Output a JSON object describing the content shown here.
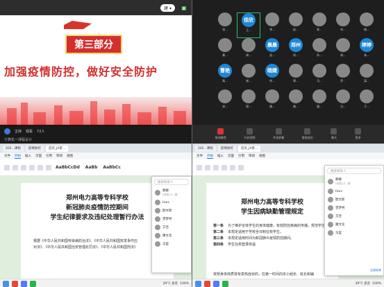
{
  "meeting": {
    "user_pill": "建 ▾",
    "slide": {
      "badge": "第三部分",
      "title": "加强疫情防控，做好安全防护"
    },
    "status": {
      "host": "主持",
      "attendees_label": "观看",
      "attendees": "72人",
      "subtitle": "计算机一课程设计"
    }
  },
  "participants": [
    {
      "name": "张...",
      "text": ""
    },
    {
      "name": "王...",
      "text": "佳欣",
      "blue": true,
      "selected": true
    },
    {
      "name": "李...",
      "text": ""
    },
    {
      "name": "赵...",
      "text": ""
    },
    {
      "name": "陈...",
      "text": ""
    },
    {
      "name": "刘...",
      "text": ""
    },
    {
      "name": "杨...",
      "text": ""
    },
    {
      "name": "黄...",
      "text": ""
    },
    {
      "name": "周...",
      "text": ""
    },
    {
      "name": "吴...",
      "text": "晨晨",
      "blue": true
    },
    {
      "name": "徐...",
      "text": "郑州",
      "blue": true
    },
    {
      "name": "孙...",
      "text": ""
    },
    {
      "name": "胡...",
      "text": ""
    },
    {
      "name": "朱...",
      "text": "婷婷",
      "blue": true
    },
    {
      "name": "高...",
      "text": "曹艳",
      "blue": true
    },
    {
      "name": "林...",
      "text": ""
    },
    {
      "name": "何...",
      "text": "晓婕",
      "blue": true
    },
    {
      "name": "郭...",
      "text": ""
    },
    {
      "name": "马...",
      "text": ""
    },
    {
      "name": "罗...",
      "text": ""
    },
    {
      "name": "梁...",
      "text": ""
    },
    {
      "name": "宋...",
      "text": ""
    },
    {
      "name": "郑...",
      "text": ""
    },
    {
      "name": "谢...",
      "text": ""
    },
    {
      "name": "韩...",
      "text": ""
    },
    {
      "name": "唐...",
      "text": ""
    },
    {
      "name": "冯...",
      "text": ""
    },
    {
      "name": "于...",
      "text": ""
    }
  ],
  "toolbar": [
    {
      "label": "取消静音",
      "red": true
    },
    {
      "label": "开启视频"
    },
    {
      "label": "共享屏幕"
    },
    {
      "label": "管理成员"
    },
    {
      "label": "聊天"
    },
    {
      "label": "更多"
    }
  ],
  "doc_left": {
    "tabs": [
      "202...课程",
      "疫情防控",
      "首页_JX系..."
    ],
    "menu": [
      "文件",
      "开始",
      "插入",
      "页面",
      "引用",
      "审阅",
      "视图"
    ],
    "active_menu": "开始",
    "style_labels": [
      "AaBbCcDd",
      "AaBb",
      "AaBbCc"
    ],
    "title_lines": [
      "郑州电力高等专科学校",
      "新冠肺炎疫情防控期间",
      "学生纪律要求及违纪处理暂行办法"
    ],
    "body": "根据《中华人民共和国传染病防治法》、《中华人民共和国突发事件应对法》、《中华人民共和国治安管理处罚法》、《中华人民共和国刑法》",
    "contacts": [
      {
        "name": "静静",
        "sub": "(本机)人..拨"
      },
      {
        "name": "Harc"
      },
      {
        "name": "欧文斯"
      },
      {
        "name": "曾梦柯"
      },
      {
        "name": "方佳"
      },
      {
        "name": "康文化"
      },
      {
        "name": "马里"
      }
    ],
    "search_placeholder": "搜索联系人",
    "temp": "29°C 多云",
    "zoom": "100%"
  },
  "doc_right": {
    "tabs": [
      "202...课程",
      "疫情防控",
      "首页_JX系..."
    ],
    "menu": [
      "文件",
      "开始",
      "插入",
      "页面",
      "引用",
      "审阅",
      "视图"
    ],
    "active_menu": "开始",
    "title_lines": [
      "郑州电力高等专科学校",
      "学生因病缺勤管理规定"
    ],
    "articles": [
      {
        "no": "第一条",
        "text": "为了维护全体学生的身体健康，有效防控疾病的传播，规范学生因病缺勤管理，特制订本规定。"
      },
      {
        "no": "第二条",
        "text": "本规定适用于学校全日制在校学生。"
      },
      {
        "no": "第三条",
        "text": "本规定适用时间为新冠肺炎疫情防控期间。"
      },
      {
        "no": "第四条",
        "text": "学生在校登录体温"
      }
    ],
    "tail": "常规身体体质变有变热症状的，应第一时间向本小组长、班长和辅",
    "contacts": [
      {
        "name": "静静",
        "sub": "(本机)人..拨"
      },
      {
        "name": "Harc"
      },
      {
        "name": "欧文斯"
      },
      {
        "name": "曾梦柯"
      },
      {
        "name": "方佳"
      },
      {
        "name": "康文化"
      },
      {
        "name": "马里"
      }
    ],
    "search_placeholder": "搜索联系人",
    "temp": "29°C 多云",
    "zoom": "100%",
    "side_label": "全部结束"
  }
}
